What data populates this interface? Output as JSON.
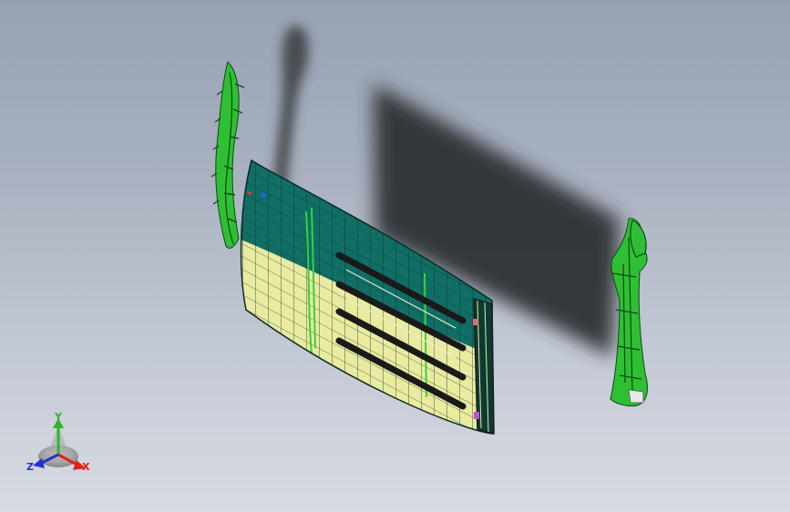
{
  "viewport": {
    "background_top": "#97a1b2",
    "background_bottom": "#d7dbe2"
  },
  "triad": {
    "x_label": "X",
    "y_label": "Y",
    "z_label": "Z",
    "x_color": "#e0201a",
    "y_color": "#2db52d",
    "z_color": "#2233cc"
  },
  "model": {
    "panel_dark": "#0f6f66",
    "panel_light": "#e8eba0",
    "bracket_green": "#39d13a",
    "shadow": "#2e3034"
  }
}
